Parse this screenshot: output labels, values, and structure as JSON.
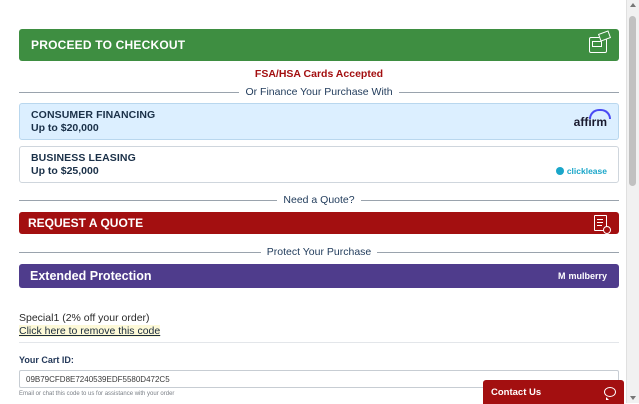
{
  "checkout": {
    "label": "PROCEED TO CHECKOUT",
    "icon": "credit-card-icon"
  },
  "fsa_note": "FSA/HSA Cards Accepted",
  "finance_divider": "Or Finance Your Purchase With",
  "consumer_financing": {
    "title": "CONSUMER FINANCING",
    "amount": "Up to $20,000",
    "brand": "affirm"
  },
  "business_leasing": {
    "title": "BUSINESS LEASING",
    "amount": "Up to $25,000",
    "brand": "clicklease"
  },
  "quote_divider": "Need a Quote?",
  "quote": {
    "label": "REQUEST A QUOTE",
    "icon": "quote-document-icon"
  },
  "protect_divider": "Protect Your Purchase",
  "protection": {
    "label": "Extended Protection",
    "brand": "mulberry",
    "brand_mark": "M"
  },
  "coupon": {
    "text": "Special1 (2% off your order)",
    "remove_link": "Click here to remove this code"
  },
  "cart": {
    "label": "Your Cart ID:",
    "id_value": "09B79CFD8E7240539EDF5580D472C5",
    "hint": "Email or chat this code to us for assistance with your order"
  },
  "contact": {
    "label": "Contact Us",
    "icon": "chat-bubble-icon"
  },
  "colors": {
    "green": "#3e8e41",
    "red": "#a30f10",
    "purple": "#4f3c8c",
    "light_blue": "#dcefff"
  }
}
